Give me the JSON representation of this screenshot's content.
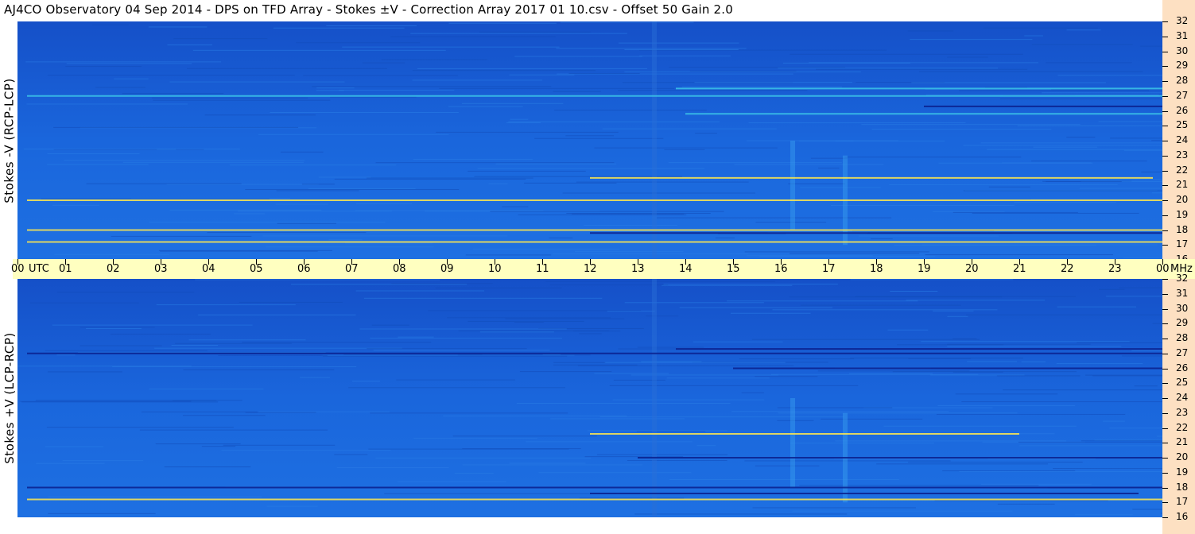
{
  "header": {
    "title": "AJ4CO Observatory  04 Sep 2014  -  DPS on TFD Array  -  Stokes ±V  -  Correction Array 2017 01 10.csv  -  Offset 50  Gain 2.0"
  },
  "chart_data": {
    "type": "heatmap",
    "colors": {
      "background": "#1a63d9",
      "low": "#0a1f8c",
      "high": "#ffe94d",
      "mid": "#3cc4e8",
      "axis_bg": "#fde0c2",
      "utc_bg": "#ffffc0"
    },
    "x_axis": {
      "unit_label": "UTC",
      "ticks": [
        "00",
        "01",
        "02",
        "03",
        "04",
        "05",
        "06",
        "07",
        "08",
        "09",
        "10",
        "11",
        "12",
        "13",
        "14",
        "15",
        "16",
        "17",
        "18",
        "19",
        "20",
        "21",
        "22",
        "23",
        "00"
      ],
      "range_hours": [
        0,
        24
      ]
    },
    "y_axis": {
      "unit_label": "MHz",
      "ticks": [
        "32",
        "31",
        "30",
        "29",
        "28",
        "27",
        "26",
        "25",
        "24",
        "23",
        "22",
        "21",
        "20",
        "19",
        "18",
        "17",
        "16"
      ],
      "range_mhz": [
        16,
        32
      ]
    },
    "panels": [
      {
        "name": "Stokes -V (RCP-LCP)",
        "ylabel": "Stokes -V (RCP-LCP)",
        "bands": [
          {
            "freq": 27.0,
            "start": 0.2,
            "end": 24,
            "tone": "mid"
          },
          {
            "freq": 20.0,
            "start": 0.2,
            "end": 24,
            "tone": "high"
          },
          {
            "freq": 21.5,
            "start": 12.0,
            "end": 23.8,
            "tone": "high"
          },
          {
            "freq": 18.0,
            "start": 0.2,
            "end": 24,
            "tone": "high"
          },
          {
            "freq": 17.2,
            "start": 0.2,
            "end": 24,
            "tone": "high"
          },
          {
            "freq": 17.8,
            "start": 12.0,
            "end": 24,
            "tone": "low"
          },
          {
            "freq": 25.8,
            "start": 14.0,
            "end": 24,
            "tone": "mid"
          },
          {
            "freq": 27.5,
            "start": 13.8,
            "end": 24,
            "tone": "mid"
          },
          {
            "freq": 26.3,
            "start": 19.0,
            "end": 24,
            "tone": "low"
          }
        ]
      },
      {
        "name": "Stokes +V (LCP-RCP)",
        "ylabel": "Stokes +V (LCP-RCP)",
        "bands": [
          {
            "freq": 27.0,
            "start": 0.2,
            "end": 24,
            "tone": "low"
          },
          {
            "freq": 20.0,
            "start": 13.0,
            "end": 24,
            "tone": "low"
          },
          {
            "freq": 21.6,
            "start": 12.0,
            "end": 21.0,
            "tone": "high"
          },
          {
            "freq": 18.0,
            "start": 0.2,
            "end": 24,
            "tone": "low"
          },
          {
            "freq": 17.2,
            "start": 0.2,
            "end": 24,
            "tone": "high"
          },
          {
            "freq": 17.6,
            "start": 12.0,
            "end": 23.5,
            "tone": "low"
          },
          {
            "freq": 27.3,
            "start": 13.8,
            "end": 24,
            "tone": "low"
          },
          {
            "freq": 26.0,
            "start": 15.0,
            "end": 24,
            "tone": "low"
          }
        ]
      }
    ]
  }
}
